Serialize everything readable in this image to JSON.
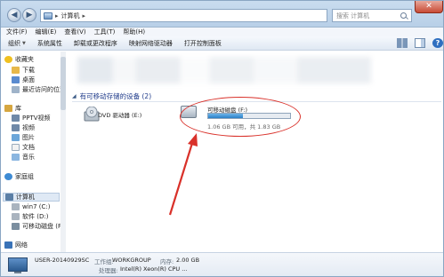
{
  "window": {
    "breadcrumb": "计算机",
    "search_placeholder": "搜索 计算机"
  },
  "menu": [
    "文件(F)",
    "编辑(E)",
    "查看(V)",
    "工具(T)",
    "帮助(H)"
  ],
  "commands": {
    "organize": "组织",
    "system_properties": "系统属性",
    "uninstall": "卸载或更改程序",
    "map_drive": "映射网络驱动器",
    "control_panel": "打开控制面板"
  },
  "sidebar": {
    "favorites": "收藏夹",
    "downloads": "下载",
    "desktop": "桌面",
    "recent": "最近访问的位置",
    "libraries": "库",
    "pptv": "PPTV视频",
    "videos": "视频",
    "pictures": "图片",
    "documents": "文档",
    "music": "音乐",
    "homegroup": "家庭组",
    "computer": "计算机",
    "drive_c": "win7 (C:)",
    "drive_d": "软件 (D:)",
    "drive_f": "可移动磁盘 (F:)",
    "network": "网络"
  },
  "content": {
    "group_header": "有可移动存储的设备 (2)",
    "dvd_label": "DVD 驱动器 (E:)",
    "usb_title": "可移动磁盘 (F:)",
    "usb_caption": "1.06 GB 可用，共 1.83 GB",
    "usb_used_fraction": 0.42
  },
  "details": {
    "computer_name": "USER-20140929SC",
    "workgroup_label": "工作组:",
    "workgroup": "WORKGROUP",
    "memory_label": "内存:",
    "memory": "2.00 GB",
    "processor_label": "处理器:",
    "processor": "Intel(R) Xeon(R) CPU ..."
  },
  "colors": {
    "annotation_red": "#d9312a",
    "accent_blue": "#2a7fc6"
  }
}
